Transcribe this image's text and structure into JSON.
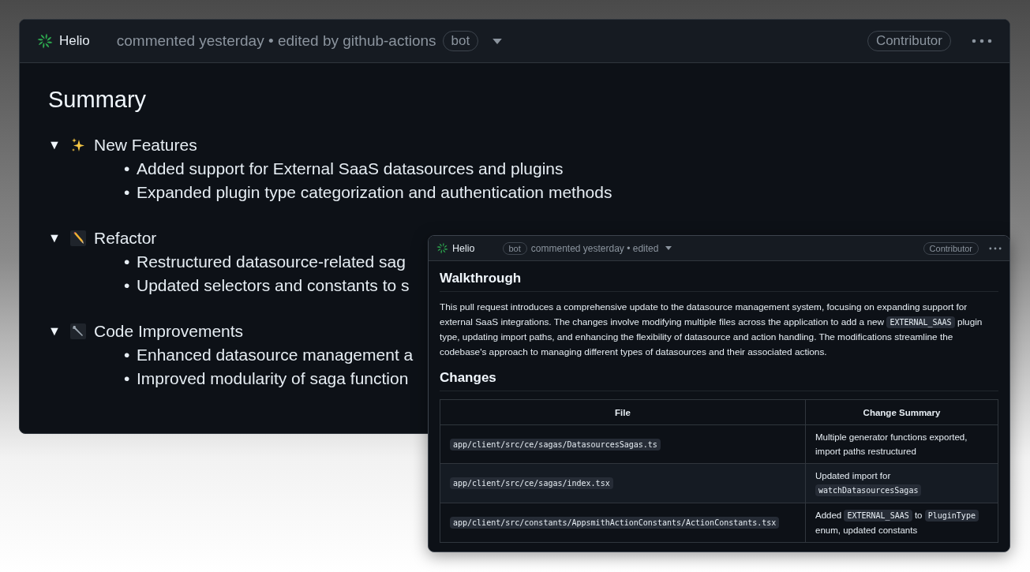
{
  "main_comment": {
    "author": "Helio",
    "meta": "commented yesterday • edited by github-actions",
    "author_badge": "bot",
    "role_badge": "Contributor",
    "title": "Summary",
    "sections": [
      {
        "toggle": "▼",
        "heading": "New Features",
        "expanded": true,
        "items": [
          {
            "bullet": "•",
            "text": "Added support for External SaaS datasources and plugins"
          },
          {
            "bullet": "•",
            "text": "Expanded plugin type categorization and authentication methods"
          }
        ]
      },
      {
        "toggle": "▼",
        "heading": "Refactor",
        "expanded": true,
        "items": [
          {
            "bullet": "•",
            "text": "Restructured datasource-related sag"
          },
          {
            "bullet": "•",
            "text": "Updated selectors and constants to s"
          }
        ]
      },
      {
        "toggle": "▼",
        "heading": "Code Improvements",
        "expanded": true,
        "items": [
          {
            "bullet": "•",
            "text": "Enhanced datasource management a"
          },
          {
            "bullet": "•",
            "text": "Improved modularity of saga function"
          }
        ]
      }
    ]
  },
  "bot_comment": {
    "author": "Helio",
    "author_badge": "bot",
    "meta": "commented yesterday • edited",
    "role_badge": "Contributor",
    "walkthrough_title": "Walkthrough",
    "walkthrough": [
      {
        "kind": "text",
        "text": "This pull request introduces a comprehensive update to the datasource management system, focusing on expanding support for external SaaS integrations. The changes involve modifying multiple files across the application to add a new "
      },
      {
        "kind": "code",
        "text": "EXTERNAL_SAAS"
      },
      {
        "kind": "text",
        "text": " plugin type, updating import paths, and enhancing the flexibility of datasource and action handling. The modifications streamline the codebase's approach to managing different types of datasources and their associated actions."
      }
    ],
    "changes_title": "Changes",
    "table": {
      "columns": [
        "File",
        "Change Summary"
      ],
      "rows": [
        {
          "file": "app/client/src/ce/sagas/DatasourcesSagas.ts",
          "summary": [
            {
              "kind": "text",
              "text": "Multiple generator functions exported, import paths restructured"
            }
          ]
        },
        {
          "file": "app/client/src/ce/sagas/index.tsx",
          "summary": [
            {
              "kind": "text",
              "text": "Updated import for "
            },
            {
              "kind": "code",
              "text": "watchDatasourcesSagas"
            }
          ]
        },
        {
          "file": "app/client/src/constants/AppsmithActionConstants/ActionConstants.tsx",
          "summary": [
            {
              "kind": "text",
              "text": "Added "
            },
            {
              "kind": "code",
              "text": "EXTERNAL_SAAS"
            },
            {
              "kind": "text",
              "text": " to "
            },
            {
              "kind": "code",
              "text": "PluginType"
            },
            {
              "kind": "text",
              "text": " enum, updated constants"
            }
          ]
        }
      ]
    }
  }
}
